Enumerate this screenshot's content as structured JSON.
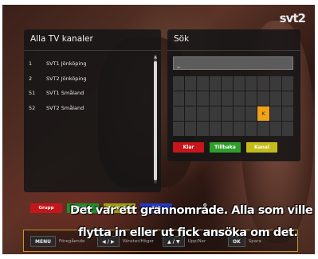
{
  "channel_logo": "svt2",
  "list_panel": {
    "title": "Alla TV kanaler",
    "channels": [
      {
        "number": "1",
        "name": "SVT1 Jönköping"
      },
      {
        "number": "2",
        "name": "SVT2 Jönköping"
      },
      {
        "number": "51",
        "name": "SVT1 Småland"
      },
      {
        "number": "52",
        "name": "SVT2 Småland"
      }
    ]
  },
  "search_panel": {
    "title": "Sök",
    "query": "_",
    "selected_key_label": "K",
    "buttons": {
      "done": "Klar",
      "back": "Tillbaka",
      "channel": "Kanal"
    }
  },
  "color_keys": {
    "red": "Grupp",
    "green": "Sortera",
    "yellow": "Favoriter",
    "blue": "Sök"
  },
  "subtitles": {
    "line1": "Det var ett grannområde. Alla som ville",
    "line2": "flytta in eller ut fick ansöka om det."
  },
  "nav": {
    "menu_key": "MENU",
    "menu_label": "Föregående",
    "lr_key": "◀ / ▶",
    "lr_label": "Vänster/Höger",
    "ud_key": "▲ / ▼",
    "ud_label": "Upp/Ner",
    "ok_key": "OK",
    "ok_label": "Spara"
  },
  "colors": {
    "red": "#c7161b",
    "green": "#2f9f2c",
    "yellow": "#c5bc19",
    "blue": "#2538c6",
    "highlight": "#f0a318",
    "nav_border": "#c59a25"
  }
}
